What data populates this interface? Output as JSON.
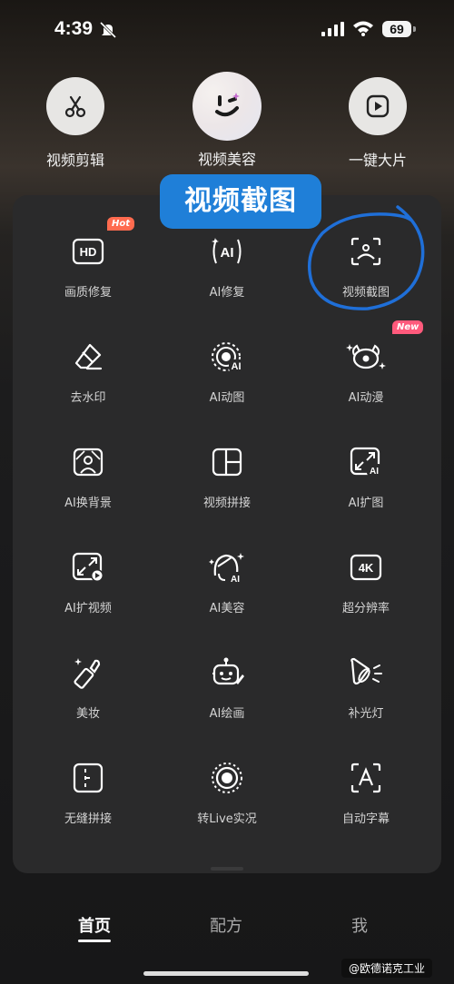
{
  "status_bar": {
    "time": "4:39",
    "battery": "69"
  },
  "top_actions": [
    {
      "label": "视频剪辑",
      "icon": "scissors-icon"
    },
    {
      "label": "视频美容",
      "icon": "wink-face-icon"
    },
    {
      "label": "一键大片",
      "icon": "play-square-icon"
    }
  ],
  "callout": {
    "text": "视频截图"
  },
  "tools": [
    {
      "label": "画质修复",
      "icon": "hd-icon",
      "badge": "Hot"
    },
    {
      "label": "AI修复",
      "icon": "ai-repair-icon"
    },
    {
      "label": "视频截图",
      "icon": "screenshot-icon"
    },
    {
      "label": "去水印",
      "icon": "eraser-icon"
    },
    {
      "label": "AI动图",
      "icon": "ai-animate-icon"
    },
    {
      "label": "AI动漫",
      "icon": "ai-anime-icon",
      "badge": "New"
    },
    {
      "label": "AI换背景",
      "icon": "background-swap-icon"
    },
    {
      "label": "视频拼接",
      "icon": "video-splice-icon"
    },
    {
      "label": "AI扩图",
      "icon": "ai-expand-image-icon"
    },
    {
      "label": "AI扩视频",
      "icon": "ai-expand-video-icon"
    },
    {
      "label": "AI美容",
      "icon": "ai-beauty-icon"
    },
    {
      "label": "超分辨率",
      "icon": "4k-icon"
    },
    {
      "label": "美妆",
      "icon": "lipstick-icon"
    },
    {
      "label": "AI绘画",
      "icon": "ai-robot-paint-icon"
    },
    {
      "label": "补光灯",
      "icon": "fill-light-icon"
    },
    {
      "label": "无缝拼接",
      "icon": "seamless-splice-icon"
    },
    {
      "label": "转Live实况",
      "icon": "live-photo-icon"
    },
    {
      "label": "自动字幕",
      "icon": "auto-subtitle-icon"
    }
  ],
  "tabs": [
    {
      "label": "首页",
      "active": true
    },
    {
      "label": "配方",
      "active": false
    },
    {
      "label": "我",
      "active": false
    }
  ],
  "watermark": "@欧德诺克工业",
  "colors": {
    "accent_blue": "#1f7fd8",
    "hot": "#ff6b4f",
    "new": "#ff5a7c"
  }
}
